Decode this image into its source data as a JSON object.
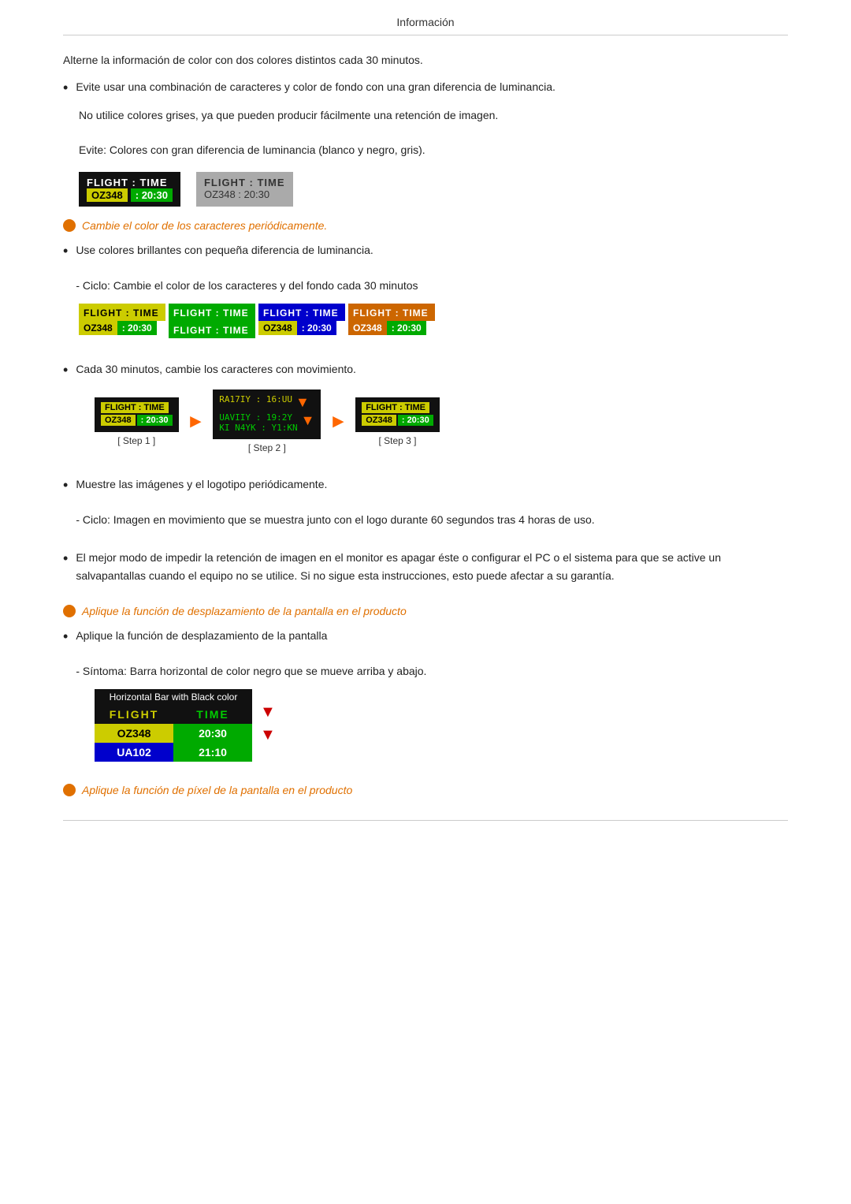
{
  "header": {
    "title": "Información"
  },
  "intro": {
    "line1": "Alterne la información de color con dos colores distintos cada 30 minutos."
  },
  "bullets": [
    {
      "type": "bullet",
      "text": "Evite usar una combinación de caracteres y color de fondo con una gran diferencia de luminancia."
    }
  ],
  "sub_block1": {
    "line1": "No utilice colores grises, ya que pueden producir fácilmente una retención de imagen.",
    "line2": "Evite: Colores con gran diferencia de luminancia (blanco y negro, gris)."
  },
  "orange_italic1": "Cambie el color de los caracteres periódicamente.",
  "bullet2": {
    "text": "Use colores brillantes con pequeña diferencia de luminancia.",
    "sub": "- Ciclo: Cambie el color de los caracteres y del fondo cada 30 minutos"
  },
  "cycle_boxes": [
    {
      "row1": "FLIGHT : TIME",
      "row2": "OZ348   : 20:30",
      "style": "yellow-black"
    },
    {
      "row1": "FLIGHT : TIME",
      "row2": "FLIGHT : TIME",
      "style": "green-white"
    },
    {
      "row1": "FLIGHT : TIME",
      "row2": "OZ348   : 20:30",
      "style": "blue-yellow"
    },
    {
      "row1": "FLIGHT : TIME",
      "row2": "OZ348   : 20:30",
      "style": "orange-green"
    }
  ],
  "bullet3": {
    "text": "Cada 30 minutos, cambie los caracteres con movimiento."
  },
  "steps": [
    {
      "label": "[ Step 1 ]",
      "row1": "FLIGHT : TIME",
      "row2": "OZ348   : 20:30"
    },
    {
      "label": "[ Step 2 ]",
      "scrambled": true
    },
    {
      "label": "[ Step 3 ]",
      "row1": "FLIGHT : TIME",
      "row2": "OZ348   : 20:30"
    }
  ],
  "bullet4": {
    "text": "Muestre las imágenes y el logotipo periódicamente.",
    "sub": "- Ciclo: Imagen en movimiento que se muestra junto con el logo durante 60 segundos tras 4 horas de uso."
  },
  "bullet5": {
    "text": "El mejor modo de impedir la retención de imagen en el monitor es apagar éste o configurar el PC o el sistema para que se active un salvapantallas cuando el equipo no se utilice. Si no sigue esta instrucciones, esto puede afectar a su garantía."
  },
  "orange_italic2": "Aplique la función de desplazamiento de la pantalla en el producto",
  "bullet6": {
    "text": "Aplique la función de desplazamiento de la pantalla",
    "sub": "- Síntoma: Barra horizontal de color negro que se mueve arriba y abajo."
  },
  "hbar": {
    "header": "Horizontal Bar with Black color",
    "row1_left": "FLIGHT",
    "row1_right": "TIME",
    "row2_left": "OZ348",
    "row2_right": "20:30",
    "row3_left": "UA102",
    "row3_right": "21:10"
  },
  "orange_italic3": "Aplique la función de píxel de la pantalla en el producto",
  "flight_box_dark": {
    "label1": "FLIGHT",
    "colon1": ":",
    "label2": "TIME",
    "code": "OZ348",
    "colon2": ":",
    "time": "20:30"
  },
  "flight_box_gray": {
    "label": "FLIGHT  :  TIME",
    "code": "OZ348   :  20:30"
  }
}
